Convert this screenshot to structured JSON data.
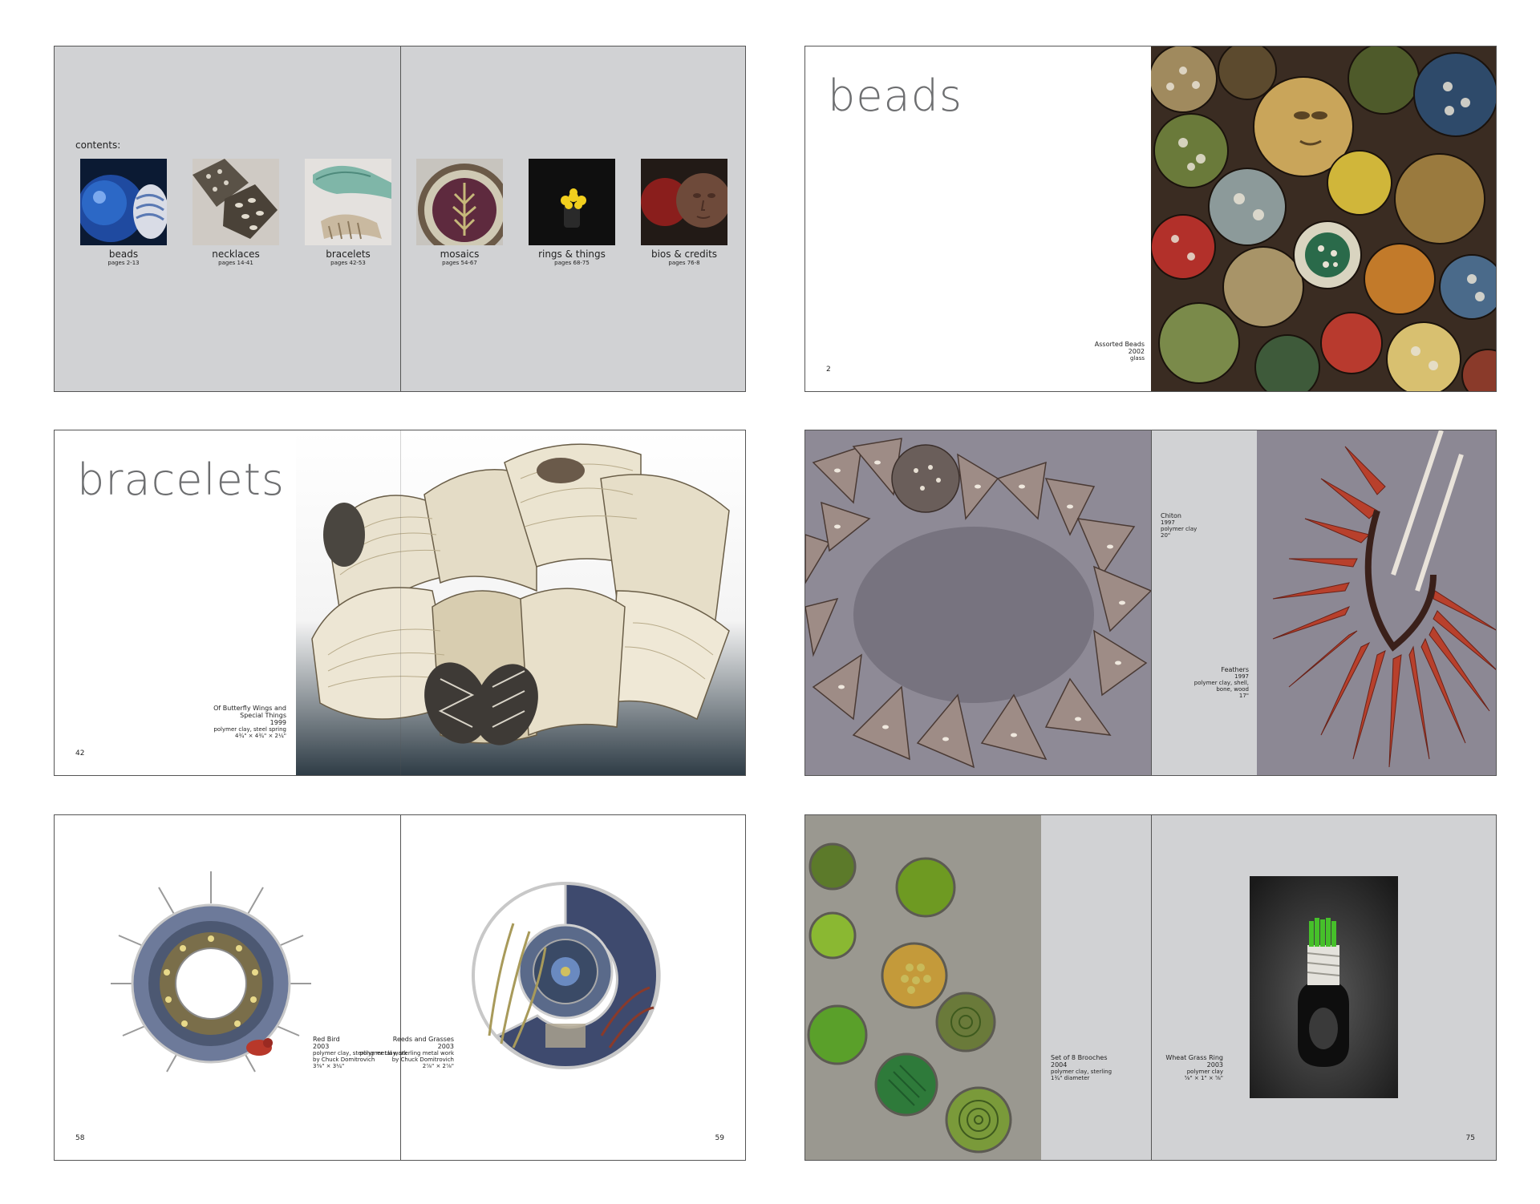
{
  "contents": {
    "heading": "contents:",
    "items": [
      {
        "label": "beads",
        "pages": "pages 2-13",
        "icon": "beads-thumbnail"
      },
      {
        "label": "necklaces",
        "pages": "pages 14-41",
        "icon": "necklaces-thumbnail"
      },
      {
        "label": "bracelets",
        "pages": "pages 42-53",
        "icon": "bracelets-thumbnail"
      },
      {
        "label": "mosaics",
        "pages": "pages 54-67",
        "icon": "mosaics-thumbnail"
      },
      {
        "label": "rings & things",
        "pages": "pages 68-75",
        "icon": "rings-thumbnail"
      },
      {
        "label": "bios & credits",
        "pages": "pages 76-8",
        "icon": "bios-thumbnail"
      }
    ]
  },
  "beads_spread": {
    "title": "beads",
    "caption": {
      "title": "Assorted Beads",
      "year": "2002",
      "medium": "glass"
    },
    "page_number": "2"
  },
  "bracelets_spread": {
    "title": "bracelets",
    "caption": {
      "title_line1": "Of Butterfly Wings and",
      "title_line2": "Special Things",
      "year": "1999",
      "medium": "polymer clay, steel spring",
      "size": "4¾\" × 4¾\" × 2¼\""
    },
    "page_number": "42"
  },
  "necklaces_spread": {
    "caption1": {
      "title": "Chiton",
      "year": "1997",
      "medium": "polymer clay",
      "size": "20\""
    },
    "caption2": {
      "title": "Feathers",
      "year": "1997",
      "medium1": "polymer clay, shell,",
      "medium2": "bone, wood",
      "size": "17\""
    }
  },
  "mosaics_spread": {
    "caption1": {
      "title": "Red Bird",
      "year": "2003",
      "medium": "polymer clay, sterling metal work",
      "credit": "by Chuck Domitrovich",
      "size": "3⅜\" × 3¼\""
    },
    "caption2": {
      "title": "Reeds and Grasses",
      "year": "2003",
      "medium": "polymer clay, sterling metal work",
      "credit": "by Chuck Domitrovich",
      "size": "2⅞\" × 2⅞\""
    },
    "page_left": "58",
    "page_right": "59"
  },
  "rings_spread": {
    "caption1": {
      "title": "Set of 8 Brooches",
      "year": "2004",
      "medium": "polymer clay, sterling",
      "size": "1¾\" diameter"
    },
    "caption2": {
      "title": "Wheat Grass Ring",
      "year": "2003",
      "medium": "polymer clay",
      "size": "⅝\" × 1\" × ⅝\""
    },
    "page_number": "75"
  }
}
